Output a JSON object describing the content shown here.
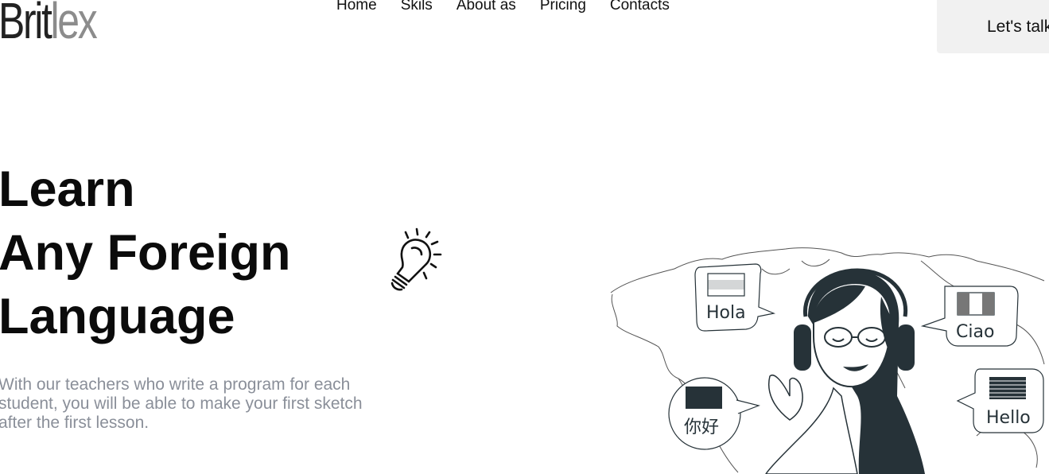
{
  "brand": {
    "part1": "Brit",
    "part2": "lex"
  },
  "nav": [
    "Home",
    "Skils",
    "About as",
    "Pricing",
    "Contacts"
  ],
  "cta": "Let's talk",
  "hero": {
    "line1": "Learn",
    "line2": "Any Foreign",
    "line3": "Language"
  },
  "subtitle": "With our teachers who write a program for each student, you will be able to make your first sketch after the first lesson.",
  "illustration": {
    "bubbles": [
      "Hola",
      "Ciao",
      "你好",
      "Hello"
    ]
  },
  "colors": {
    "text": "#111111",
    "muted": "#8a8f99",
    "cta_bg": "#f1f1f1",
    "ink": "#263238"
  },
  "icons": [
    "lightbulb-icon",
    "world-map",
    "headphones"
  ]
}
